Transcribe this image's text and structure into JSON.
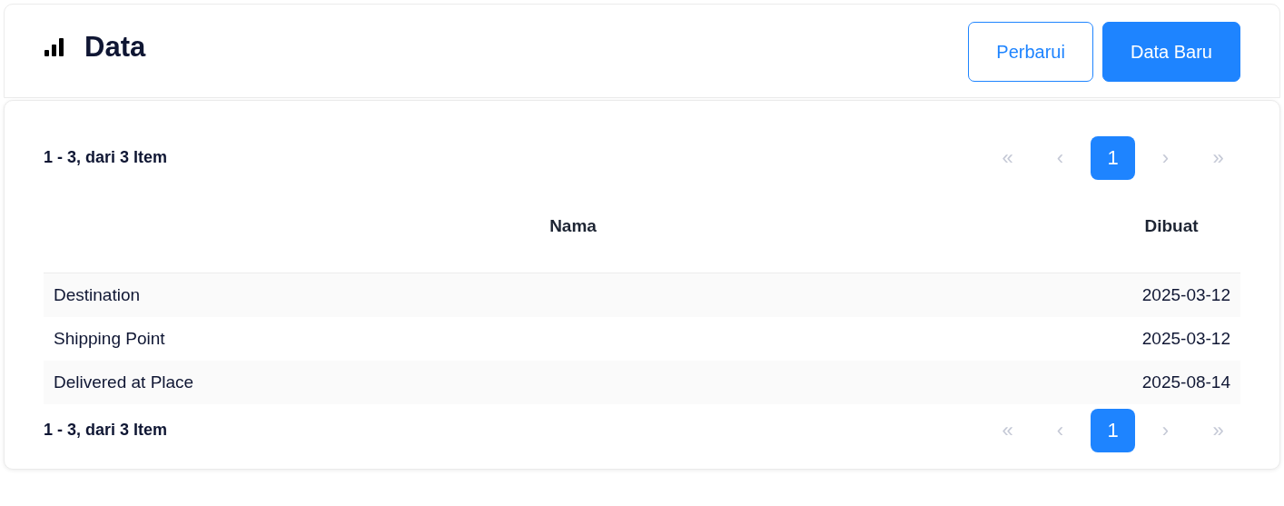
{
  "header": {
    "title": "Data",
    "buttons": [
      {
        "label": "Perbarui",
        "kind": "outline"
      },
      {
        "label": "Data Baru",
        "kind": "primary"
      }
    ]
  },
  "pagination_top": {
    "summary": "1 - 3, dari 3 Item",
    "pages": [
      {
        "label": "«",
        "selected": false,
        "disabled": true
      },
      {
        "label": "‹",
        "selected": false,
        "disabled": true
      },
      {
        "label": "1",
        "selected": true,
        "disabled": false
      },
      {
        "label": "›",
        "selected": false,
        "disabled": true
      },
      {
        "label": "»",
        "selected": false,
        "disabled": true
      }
    ]
  },
  "table": {
    "columns": [
      "Nama",
      "Dibuat"
    ],
    "rows": [
      [
        "Destination",
        "2025-03-12"
      ],
      [
        "Shipping Point",
        "2025-03-12"
      ],
      [
        "Delivered at Place",
        "2025-08-14"
      ]
    ]
  },
  "pagination_bottom": {
    "summary": "1 - 3, dari 3 Item",
    "pages": [
      {
        "label": "«",
        "selected": false,
        "disabled": true
      },
      {
        "label": "‹",
        "selected": false,
        "disabled": true
      },
      {
        "label": "1",
        "selected": true,
        "disabled": false
      },
      {
        "label": "›",
        "selected": false,
        "disabled": true
      },
      {
        "label": "»",
        "selected": false,
        "disabled": true
      }
    ]
  }
}
